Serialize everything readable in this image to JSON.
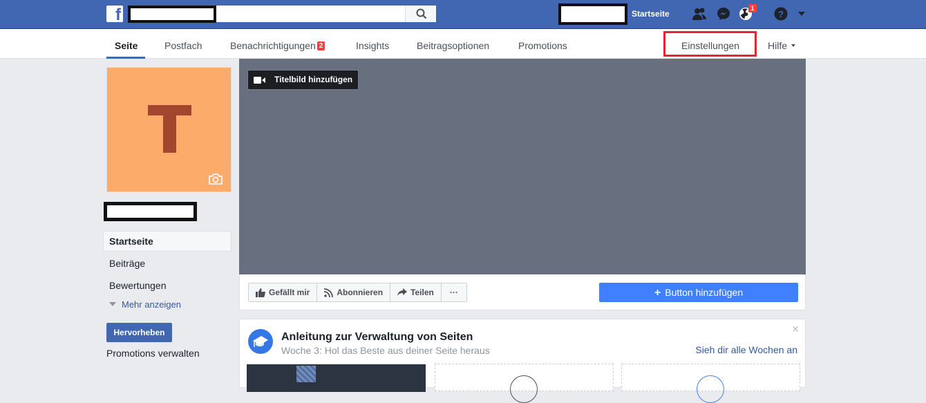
{
  "topbar": {
    "logo": "f",
    "search_placeholder": "",
    "home_label": "Startseite",
    "notifications_badge": "1",
    "icons": [
      "friends-icon",
      "messenger-icon",
      "globe-notifications-icon",
      "help-icon",
      "account-caret-icon"
    ]
  },
  "pagenav": {
    "tabs": [
      {
        "label": "Seite",
        "active": true
      },
      {
        "label": "Postfach"
      },
      {
        "label": "Benachrichtigungen",
        "badge": "2"
      },
      {
        "label": "Insights"
      },
      {
        "label": "Beitragsoptionen"
      },
      {
        "label": "Promotions"
      }
    ],
    "settings_label": "Einstellungen",
    "help_label": "Hilfe",
    "highlight_color": "#e8242f"
  },
  "profile": {
    "initial": "T",
    "bg_color": "#fdab6b",
    "letter_color": "#a2472e"
  },
  "sidebar": {
    "items": [
      {
        "label": "Startseite",
        "active": true
      },
      {
        "label": "Beiträge"
      },
      {
        "label": "Bewertungen"
      }
    ],
    "more_label": "Mehr anzeigen",
    "promote_label": "Hervorheben",
    "manage_promos_label": "Promotions verwalten"
  },
  "cover": {
    "add_cover_label": "Titelbild hinzufügen"
  },
  "actions": {
    "like_label": "Gefällt mir",
    "follow_label": "Abonnieren",
    "share_label": "Teilen",
    "more_label": "···",
    "add_button_label": "Button hinzufügen",
    "add_button_color": "#4080ff"
  },
  "guide": {
    "title": "Anleitung zur Verwaltung von Seiten",
    "subtitle": "Woche 3: Hol das Beste aus deiner Seite heraus",
    "see_all_label": "Sieh dir alle Wochen an",
    "close_label": "✕"
  }
}
